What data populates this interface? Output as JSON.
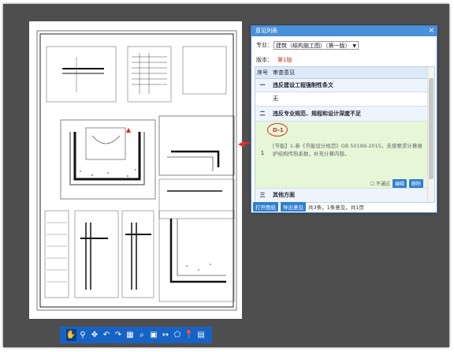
{
  "toolbar": {
    "items": [
      {
        "name": "pan-hand-icon",
        "glyph": "✋",
        "active": true
      },
      {
        "name": "pin-icon",
        "glyph": "⚲"
      },
      {
        "name": "fit-icon",
        "glyph": "✥"
      },
      {
        "name": "undo-icon",
        "glyph": "↶"
      },
      {
        "name": "redo-icon",
        "glyph": "↷"
      },
      {
        "name": "grid-icon",
        "glyph": "▦"
      },
      {
        "name": "zoom-icon",
        "glyph": "⌕"
      },
      {
        "name": "frame-icon",
        "glyph": "▣"
      },
      {
        "name": "measure-icon",
        "glyph": "↔"
      },
      {
        "name": "polygon-icon",
        "glyph": "⬠"
      },
      {
        "name": "location-icon",
        "glyph": "📍"
      },
      {
        "name": "layers-icon",
        "glyph": "▤"
      }
    ]
  },
  "panel": {
    "title": "意见列表",
    "close": "×",
    "specialty_label": "专业：",
    "specialty_value": "建筑（结构施工图）（第一版）",
    "version_label": "版本：",
    "version_value": "第1版",
    "table": {
      "col_no": "序号",
      "col_content": "审查意见",
      "rows": [
        {
          "no": "一",
          "text": "违反建设工程强制性条文",
          "kind": "sec"
        },
        {
          "no": "",
          "text": "无",
          "kind": "plain"
        },
        {
          "no": "二",
          "text": "违反专业规范、规程和设计深度不足",
          "kind": "sec"
        }
      ],
      "selected": {
        "no": "1",
        "code": "D-1",
        "text": "[节能】1.参《节能设计规范》GB 50189-2015，未按要求计算维护结构传热系数，补充计算内容。",
        "checkbox_label": "不通过",
        "edit_label": "编辑",
        "delete_label": "删除"
      },
      "last_row": {
        "no": "三",
        "text": "其他方面"
      }
    },
    "footer": {
      "open_label": "打开图纸",
      "export_label": "导出意见",
      "info": "共3条，1条意见，共1页"
    }
  }
}
